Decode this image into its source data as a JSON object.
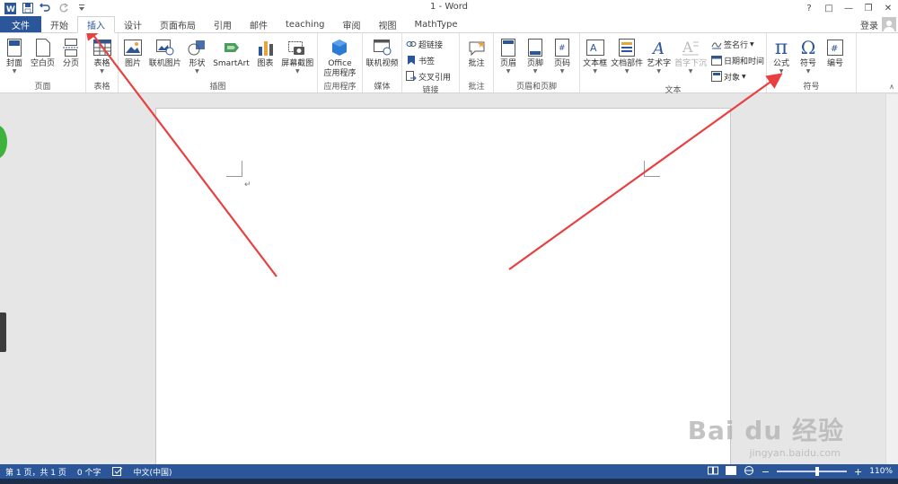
{
  "window": {
    "title": "1 - Word",
    "help": "?",
    "controls": [
      "□",
      "—",
      "❐",
      "✕"
    ]
  },
  "tabs": [
    {
      "label": "文件",
      "type": "file"
    },
    {
      "label": "开始"
    },
    {
      "label": "插入",
      "active": true
    },
    {
      "label": "设计"
    },
    {
      "label": "页面布局"
    },
    {
      "label": "引用"
    },
    {
      "label": "邮件"
    },
    {
      "label": "teaching"
    },
    {
      "label": "审阅"
    },
    {
      "label": "视图"
    },
    {
      "label": "MathType"
    }
  ],
  "account": {
    "login": "登录"
  },
  "ribbon": {
    "pages": {
      "label": "页面",
      "cover": "封面",
      "blank": "空白页",
      "break": "分页"
    },
    "tables": {
      "label": "表格",
      "table": "表格"
    },
    "illustrations": {
      "label": "插图",
      "picture": "图片",
      "online_picture": "联机图片",
      "shapes": "形状",
      "smartart": "SmartArt",
      "chart": "图表",
      "screenshot": "屏幕截图"
    },
    "apps": {
      "label": "应用程序",
      "office_line1": "Office",
      "office_line2": "应用程序"
    },
    "media": {
      "label": "媒体",
      "online_video": "联机视频"
    },
    "links": {
      "label": "链接",
      "hyperlink": "超链接",
      "bookmark": "书签",
      "cross_ref": "交叉引用"
    },
    "comments": {
      "label": "批注",
      "comment": "批注"
    },
    "header_footer": {
      "label": "页眉和页脚",
      "header": "页眉",
      "footer": "页脚",
      "page_number": "页码"
    },
    "text": {
      "label": "文本",
      "textbox": "文本框",
      "quick_parts": "文档部件",
      "wordart": "艺术字",
      "dropcap": "首字下沉",
      "signature": "签名行",
      "datetime": "日期和时间",
      "object": "对象"
    },
    "symbols": {
      "label": "符号",
      "equation": "公式",
      "symbol": "符号",
      "number": "编号",
      "pi": "π",
      "omega": "Ω"
    }
  },
  "document": {
    "para_mark": "↵"
  },
  "watermark": {
    "main": "Bai du 经验",
    "sub": "jingyan.baidu.com"
  },
  "status": {
    "page": "第 1 页，共 1 页",
    "words": "0 个字",
    "language": "中文(中国)",
    "zoom_minus": "−",
    "zoom_plus": "+",
    "zoom": "110%",
    "zoom_fraction": 0.55
  },
  "colors": {
    "accent": "#2b579a",
    "arrow": "#e84040"
  }
}
